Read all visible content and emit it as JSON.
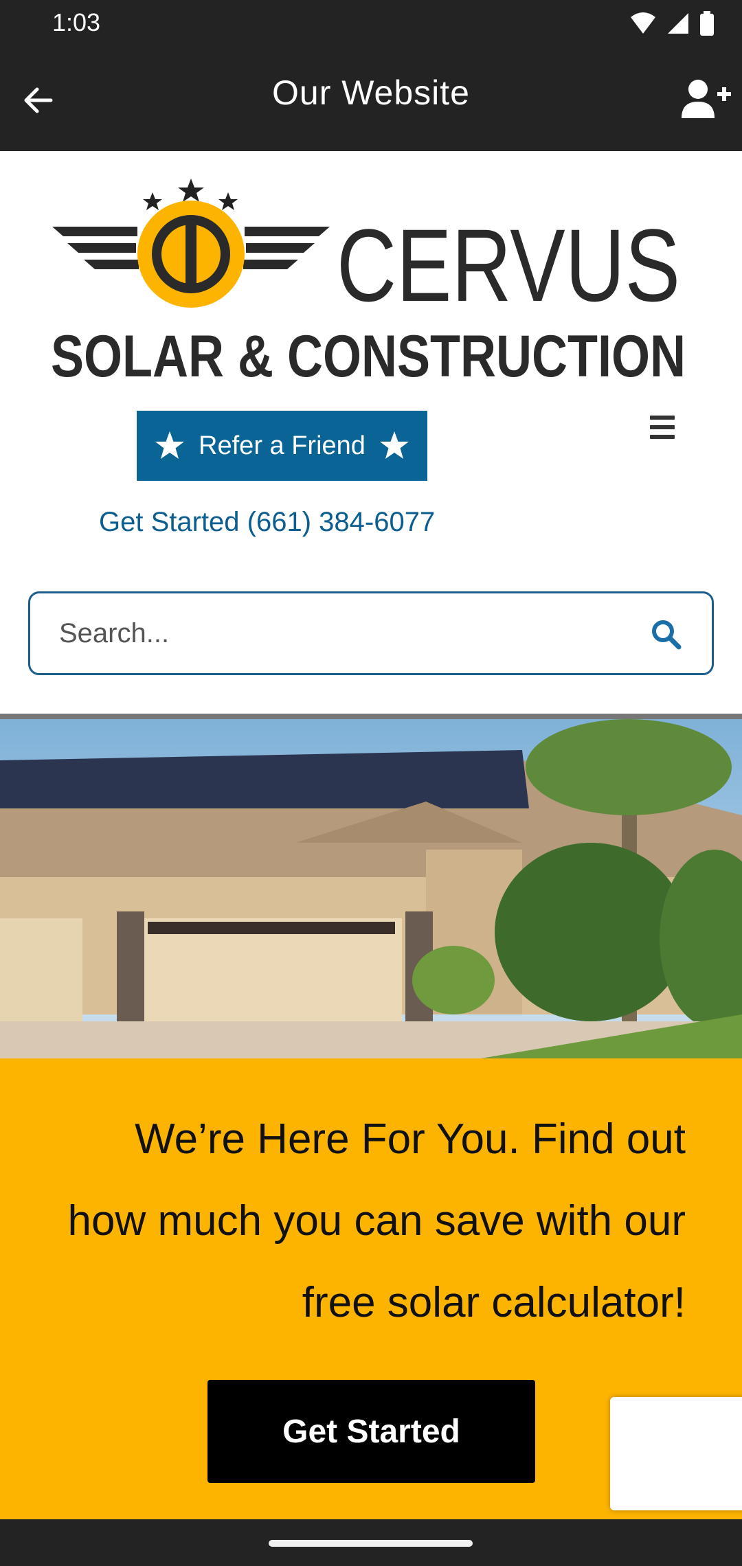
{
  "status_bar": {
    "time": "1:03"
  },
  "app_bar": {
    "title": "Our Website"
  },
  "logo": {
    "line1": "CERVUS",
    "line2": "SOLAR & CONSTRUCTION"
  },
  "refer_button": {
    "label": "Refer a Friend"
  },
  "phone_link": {
    "label": "Get Started (661) 384-6077"
  },
  "search": {
    "placeholder": "Search..."
  },
  "promo": {
    "text": "We’re Here For You. Find out how much you can save with our free solar calculator!",
    "button_label": "Get Started"
  },
  "colors": {
    "bar": "#232323",
    "brand_blue": "#0a6496",
    "brand_yellow": "#fdb400"
  }
}
